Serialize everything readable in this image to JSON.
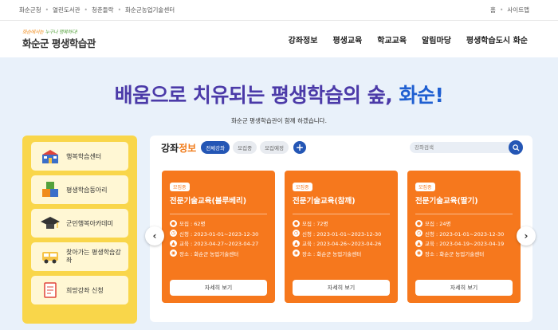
{
  "topbar": {
    "links": [
      "화순군청",
      "열린도서관",
      "청춘들락",
      "화순군농업기술센터"
    ],
    "util": [
      "홈",
      "사이트맵"
    ]
  },
  "logo": {
    "slogan_a": "화순에서는",
    "slogan_b": "누구나 행복하다!",
    "name": "화순군 평생학습관"
  },
  "gnb": [
    "강좌정보",
    "평생교육",
    "학교교육",
    "알림마당",
    "평생학습도시 화순"
  ],
  "hero": {
    "title_main": "배움으로 치유되는 평생학습의 숲,",
    "title_accent": "화순!",
    "subtitle": "화순군 평생학습관이 함께 하겠습니다."
  },
  "quick_menu": [
    {
      "label": "행복학습센터",
      "icon": "school-building-icon"
    },
    {
      "label": "평생학습동아리",
      "icon": "blocks-icon"
    },
    {
      "label": "군민행복아카데미",
      "icon": "graduation-cap-icon"
    },
    {
      "label": "찾아가는 평생학습강좌",
      "icon": "bus-icon"
    },
    {
      "label": "희망강좌 신청",
      "icon": "application-form-icon"
    }
  ],
  "courses": {
    "title_a": "강좌",
    "title_b": "정보",
    "tabs": [
      "전체강좌",
      "모집중",
      "모집예정"
    ],
    "search_placeholder": "강좌검색",
    "cards": [
      {
        "badge": "모집중",
        "title": "전문기술교육(블루베리)",
        "capacity": "모집 : 62명",
        "apply": "신청 : 2023-01-01~2023-12-30",
        "period": "교육 : 2023-04-27~2023-04-27",
        "place": "장소 : 화순군 농업기술센터",
        "more": "자세히 보기"
      },
      {
        "badge": "모집중",
        "title": "전문기술교육(참깨)",
        "capacity": "모집 : 72명",
        "apply": "신청 : 2023-01-01~2023-12-30",
        "period": "교육 : 2023-04-26~2023-04-26",
        "place": "장소 : 화순군 농업기술센터",
        "more": "자세히 보기"
      },
      {
        "badge": "모집중",
        "title": "전문기술교육(딸기)",
        "capacity": "모집 : 24명",
        "apply": "신청 : 2023-01-01~2023-12-30",
        "period": "교육 : 2023-04-19~2023-04-19",
        "place": "장소 : 화순군 농업기술센터",
        "more": "자세히 보기"
      }
    ]
  },
  "colors": {
    "card_orange": "#f6781d",
    "quick_yellow": "#f9d64a",
    "brand_blue": "#2456b5",
    "hero_purple": "#4b3aa8"
  }
}
